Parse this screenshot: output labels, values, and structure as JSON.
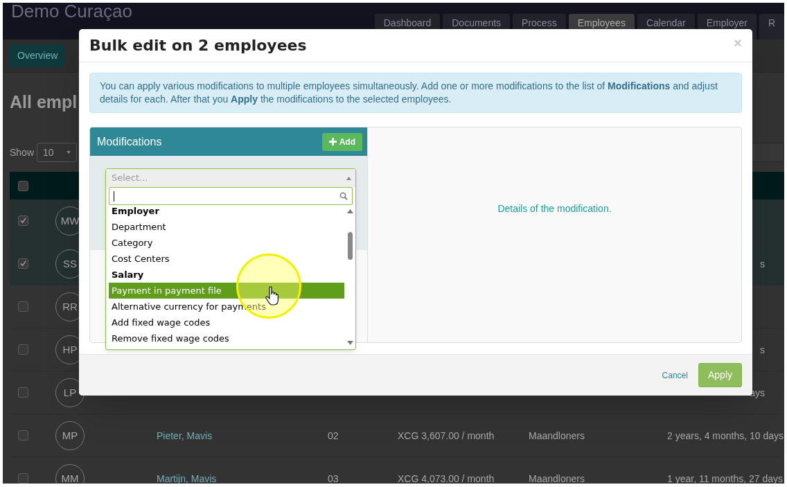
{
  "app": {
    "title": "Demo Curaçao",
    "tabs": [
      {
        "label": "Dashboard",
        "selected": false
      },
      {
        "label": "Documents",
        "selected": false
      },
      {
        "label": "Process",
        "selected": false
      },
      {
        "label": "Employees",
        "selected": true
      },
      {
        "label": "Calendar",
        "selected": false
      },
      {
        "label": "Employer",
        "selected": false
      },
      {
        "label": "R",
        "selected": false
      }
    ],
    "overview_button": "Overview",
    "heading": "All empl",
    "show_label": "Show",
    "page_size": "10",
    "table": {
      "header_checked": false,
      "rows": [
        {
          "initials": "MW",
          "checked": true
        },
        {
          "initials": "SS",
          "checked": true,
          "tenure": "s"
        },
        {
          "initials": "RR",
          "checked": false
        },
        {
          "initials": "HP",
          "checked": false,
          "tenure": "s"
        },
        {
          "initials": "LP",
          "checked": false,
          "tenure": "ays"
        },
        {
          "initials": "MP",
          "checked": false,
          "name": "Pieter, Mavis",
          "code": "02",
          "salary": "XCG 3,607.00 / month",
          "category": "Maandloners",
          "tenure": "2 years, 4 months, 10 days"
        },
        {
          "initials": "MM",
          "checked": false,
          "name": "Martijn, Mavis",
          "code": "03",
          "salary": "XCG 4,073.00 / month",
          "category": "Maandloners",
          "tenure": "1 year, 11 months, 27 days"
        }
      ]
    }
  },
  "modal": {
    "title": "Bulk edit on 2 employees",
    "close": "×",
    "info": "You can apply various modifications to multiple employees simultaneously. Add one or more modifications to the list of **Modifications** and adjust details for each. After that you **Apply** the modifications to the selected employees.",
    "panel_title": "Modifications",
    "add_button": "Add",
    "select": {
      "placeholder": "Select...",
      "options": [
        {
          "label": "Employer",
          "kind": "group",
          "selected": false
        },
        {
          "label": "Department",
          "kind": "option",
          "selected": false
        },
        {
          "label": "Category",
          "kind": "option",
          "selected": false
        },
        {
          "label": "Cost Centers",
          "kind": "option",
          "selected": false
        },
        {
          "label": "Salary",
          "kind": "group",
          "selected": false
        },
        {
          "label": "Payment in payment file",
          "kind": "option",
          "selected": true
        },
        {
          "label": "Alternative currency for payments",
          "kind": "option",
          "selected": false
        },
        {
          "label": "Add fixed wage codes",
          "kind": "option",
          "selected": false
        },
        {
          "label": "Remove fixed wage codes",
          "kind": "option",
          "selected": false
        }
      ]
    },
    "details": "Details of the modification.",
    "cancel": "Cancel",
    "apply": "Apply"
  }
}
